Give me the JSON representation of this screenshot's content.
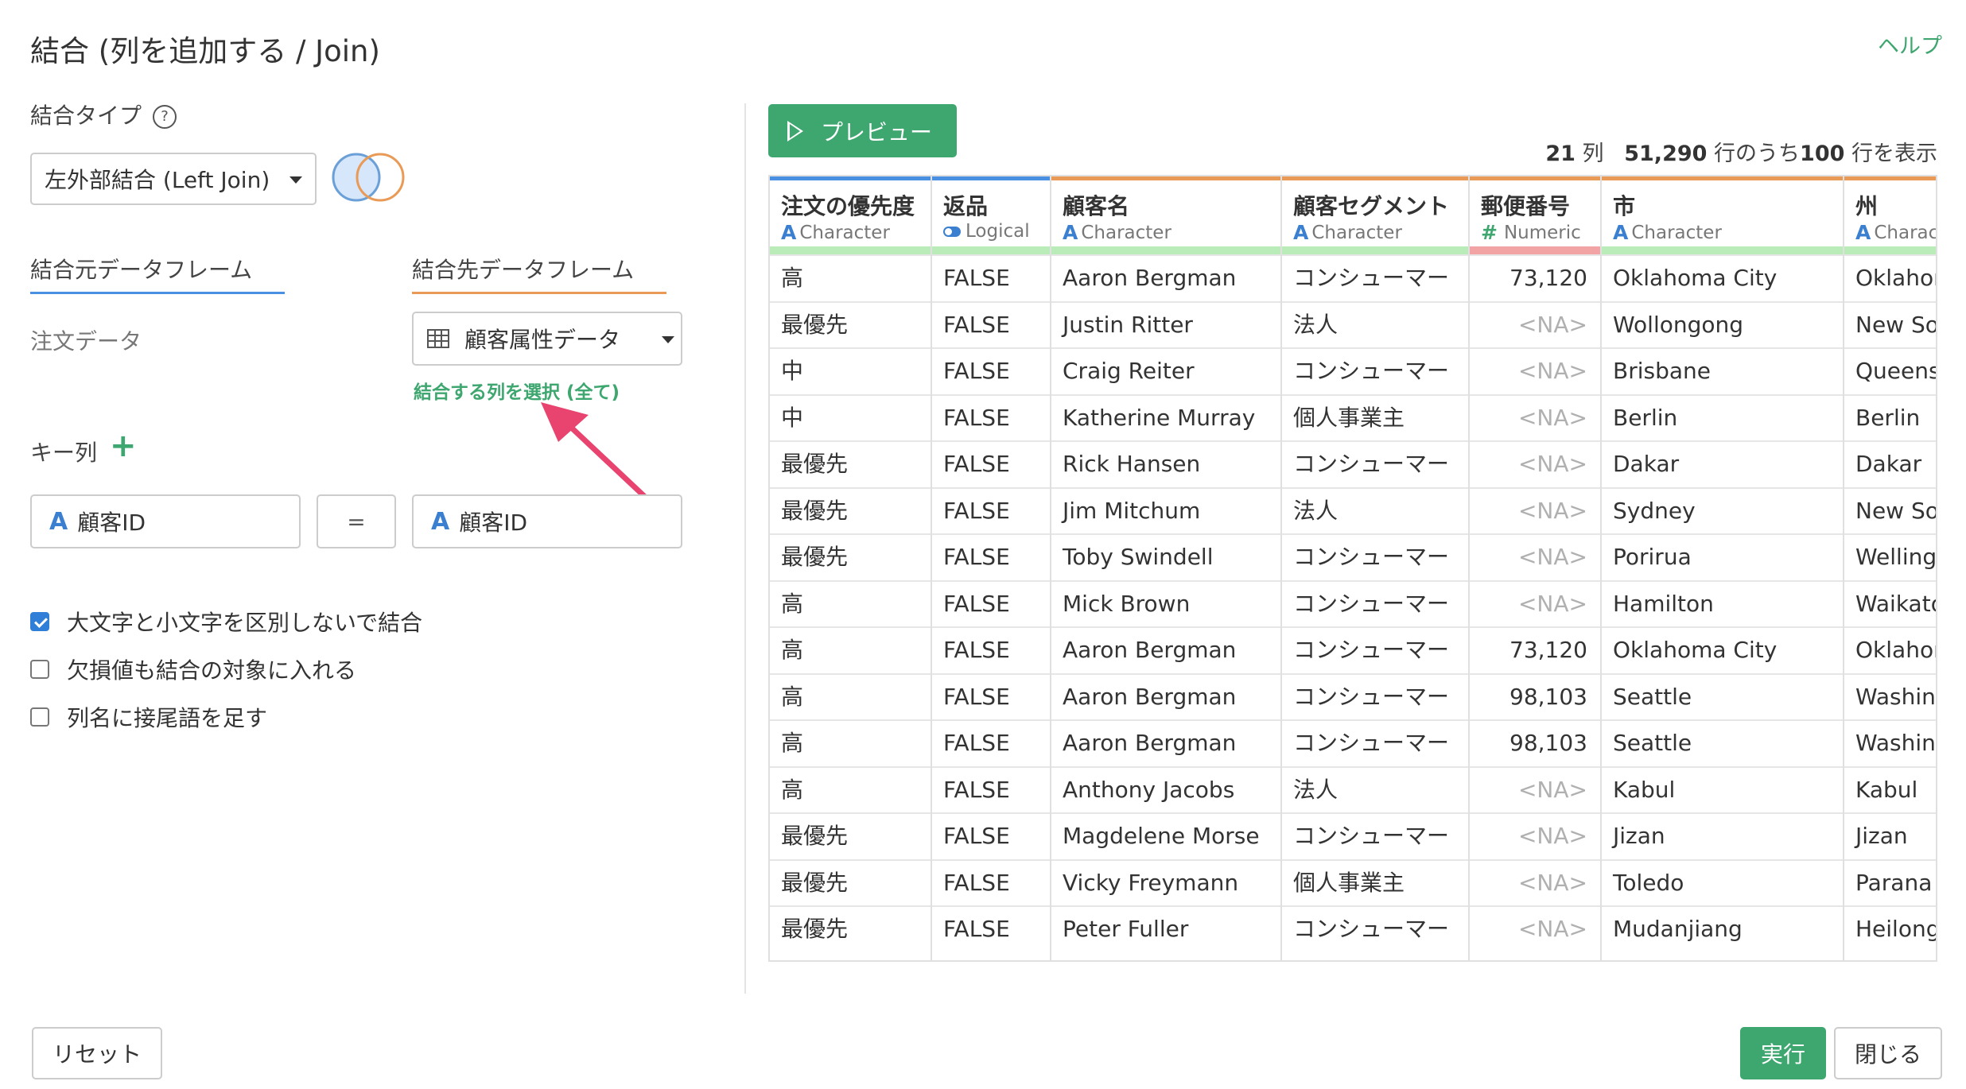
{
  "dialog": {
    "title": "結合 (列を追加する / Join)",
    "help_label": "ヘルプ"
  },
  "left": {
    "join_type_label": "結合タイプ",
    "join_type_help": "?",
    "join_type_value": "左外部結合 (Left Join)",
    "source_tab_label": "結合元データフレーム",
    "target_tab_label": "結合先データフレーム",
    "source_frame": "注文データ",
    "target_frame": "顧客属性データ",
    "select_columns_link": "結合する列を選択 (全て)",
    "key_label": "キー列",
    "key_add": "+",
    "key_left_type": "A",
    "key_left": "顧客ID",
    "key_equals": "=",
    "key_right_type": "A",
    "key_right": "顧客ID",
    "options": [
      {
        "label": "大文字と小文字を区別しないで結合",
        "checked": true
      },
      {
        "label": "欠損値も結合の対象に入れる",
        "checked": false
      },
      {
        "label": "列名に接尾語を足す",
        "checked": false
      }
    ],
    "reset_label": "リセット"
  },
  "preview": {
    "button_label": "プレビュー",
    "summary_cols": "21",
    "summary_cols_unit": "列",
    "summary_rows_total": "51,290",
    "summary_rows_mid": "行のうち",
    "summary_rows_shown": "100",
    "summary_rows_end": "行を表示"
  },
  "table": {
    "columns": [
      {
        "name": "注文の優先度",
        "type": "Character",
        "type_icon": "A",
        "accent": "#4a90e2",
        "bar": "#b9ecb9"
      },
      {
        "name": "返品",
        "type": "Logical",
        "type_icon": "toggle",
        "accent": "#4a90e2",
        "bar": "#b9ecb9"
      },
      {
        "name": "顧客名",
        "type": "Character",
        "type_icon": "A",
        "accent": "#e89a56",
        "bar": "#b9ecb9"
      },
      {
        "name": "顧客セグメント",
        "type": "Character",
        "type_icon": "A",
        "accent": "#e89a56",
        "bar": "#b9ecb9"
      },
      {
        "name": "郵便番号",
        "type": "Numeric",
        "type_icon": "#",
        "accent": "#e89a56",
        "bar": "#f2a3a3"
      },
      {
        "name": "市",
        "type": "Character",
        "type_icon": "A",
        "accent": "#e89a56",
        "bar": "#b9ecb9"
      },
      {
        "name": "州",
        "type": "Charac",
        "type_icon": "A",
        "accent": "#e89a56",
        "bar": "#b9ecb9"
      }
    ],
    "rows": [
      [
        "高",
        "FALSE",
        "Aaron Bergman",
        "コンシューマー",
        "73,120",
        "Oklahoma City",
        "Oklahoma"
      ],
      [
        "最優先",
        "FALSE",
        "Justin Ritter",
        "法人",
        "<NA>",
        "Wollongong",
        "New South Wales"
      ],
      [
        "中",
        "FALSE",
        "Craig Reiter",
        "コンシューマー",
        "<NA>",
        "Brisbane",
        "Queensland"
      ],
      [
        "中",
        "FALSE",
        "Katherine Murray",
        "個人事業主",
        "<NA>",
        "Berlin",
        "Berlin"
      ],
      [
        "最優先",
        "FALSE",
        "Rick Hansen",
        "コンシューマー",
        "<NA>",
        "Dakar",
        "Dakar"
      ],
      [
        "最優先",
        "FALSE",
        "Jim Mitchum",
        "法人",
        "<NA>",
        "Sydney",
        "New South Wales"
      ],
      [
        "最優先",
        "FALSE",
        "Toby Swindell",
        "コンシューマー",
        "<NA>",
        "Porirua",
        "Wellington"
      ],
      [
        "高",
        "FALSE",
        "Mick Brown",
        "コンシューマー",
        "<NA>",
        "Hamilton",
        "Waikato"
      ],
      [
        "高",
        "FALSE",
        "Aaron Bergman",
        "コンシューマー",
        "73,120",
        "Oklahoma City",
        "Oklahoma"
      ],
      [
        "高",
        "FALSE",
        "Aaron Bergman",
        "コンシューマー",
        "98,103",
        "Seattle",
        "Washington"
      ],
      [
        "高",
        "FALSE",
        "Aaron Bergman",
        "コンシューマー",
        "98,103",
        "Seattle",
        "Washington"
      ],
      [
        "高",
        "FALSE",
        "Anthony Jacobs",
        "法人",
        "<NA>",
        "Kabul",
        "Kabul"
      ],
      [
        "最優先",
        "FALSE",
        "Magdelene Morse",
        "コンシューマー",
        "<NA>",
        "Jizan",
        "Jizan"
      ],
      [
        "最優先",
        "FALSE",
        "Vicky Freymann",
        "個人事業主",
        "<NA>",
        "Toledo",
        "Parana"
      ],
      [
        "最優先",
        "FALSE",
        "Peter Fuller",
        "コンシューマー",
        "<NA>",
        "Mudanjiang",
        "Heilongjiang"
      ]
    ]
  },
  "footer": {
    "run_label": "実行",
    "close_label": "閉じる"
  },
  "colors": {
    "accent_green": "#3ea66f",
    "accent_blue": "#4a90e2",
    "accent_orange": "#e89a56",
    "annotation_arrow": "#e8446f"
  },
  "icons": {
    "join_venn": "venn-left-join-icon",
    "table_icon": "table-grid-icon",
    "play_icon": "play-icon",
    "dropdown": "chevron-down-icon",
    "annotation": "pink-arrow"
  }
}
